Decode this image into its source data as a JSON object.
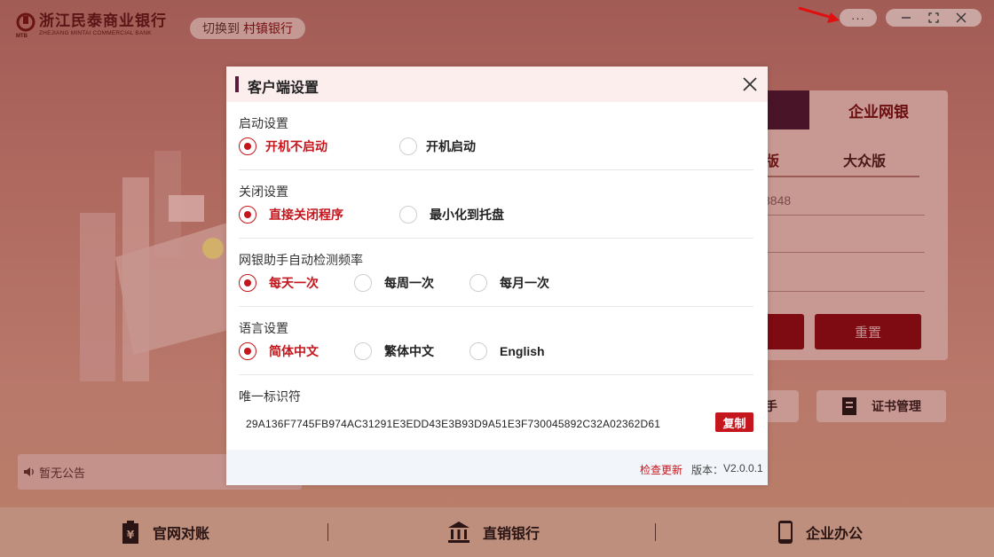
{
  "app": {
    "bank_name": "浙江民泰商业银行",
    "bank_name_en": "ZHEJIANG MINTAI COMMERCIAL BANK",
    "logo_tag": "MTB",
    "switch_prefix": "切换到",
    "switch_target": "村镇银行",
    "more_label": "···"
  },
  "login": {
    "tab_enterprise": "企业网银",
    "sub_tab_1": "版",
    "sub_tab_2": "大众版",
    "phone_partial": "8848",
    "reset_label": "重置"
  },
  "tools": {
    "tool_1_label": "手",
    "tool_2_label": "证书管理"
  },
  "notice": {
    "text": "暂无公告"
  },
  "bottom_nav": [
    {
      "label": "官网对账"
    },
    {
      "label": "直销银行"
    },
    {
      "label": "企业办公"
    }
  ],
  "dialog": {
    "title": "客户端设置",
    "startup": {
      "label": "启动设置",
      "options": [
        "开机不启动",
        "开机启动"
      ],
      "selected": "开机不启动"
    },
    "close": {
      "label": "关闭设置",
      "options": [
        "直接关闭程序",
        "最小化到托盘"
      ],
      "selected": "直接关闭程序"
    },
    "frequency": {
      "label": "网银助手自动检测频率",
      "options": [
        "每天一次",
        "每周一次",
        "每月一次"
      ],
      "selected": "每天一次"
    },
    "language": {
      "label": "语言设置",
      "options": [
        "简体中文",
        "繁体中文",
        "English"
      ],
      "selected": "简体中文"
    },
    "uid": {
      "label": "唯一标识符",
      "value": "29A136F7745FB974AC31291E3EDD43E3B93D9A51E3F730045892C32A02362D61",
      "copy_label": "复制"
    },
    "footer": {
      "check_update": "检查更新",
      "version_label": "版本：",
      "version": "V2.0.0.1"
    }
  },
  "colors": {
    "accent": "#c4161c",
    "dialog_header_bg": "#fdeeee",
    "title_bar": "#5a1a3a",
    "overlay_bg": "#a25c56"
  }
}
